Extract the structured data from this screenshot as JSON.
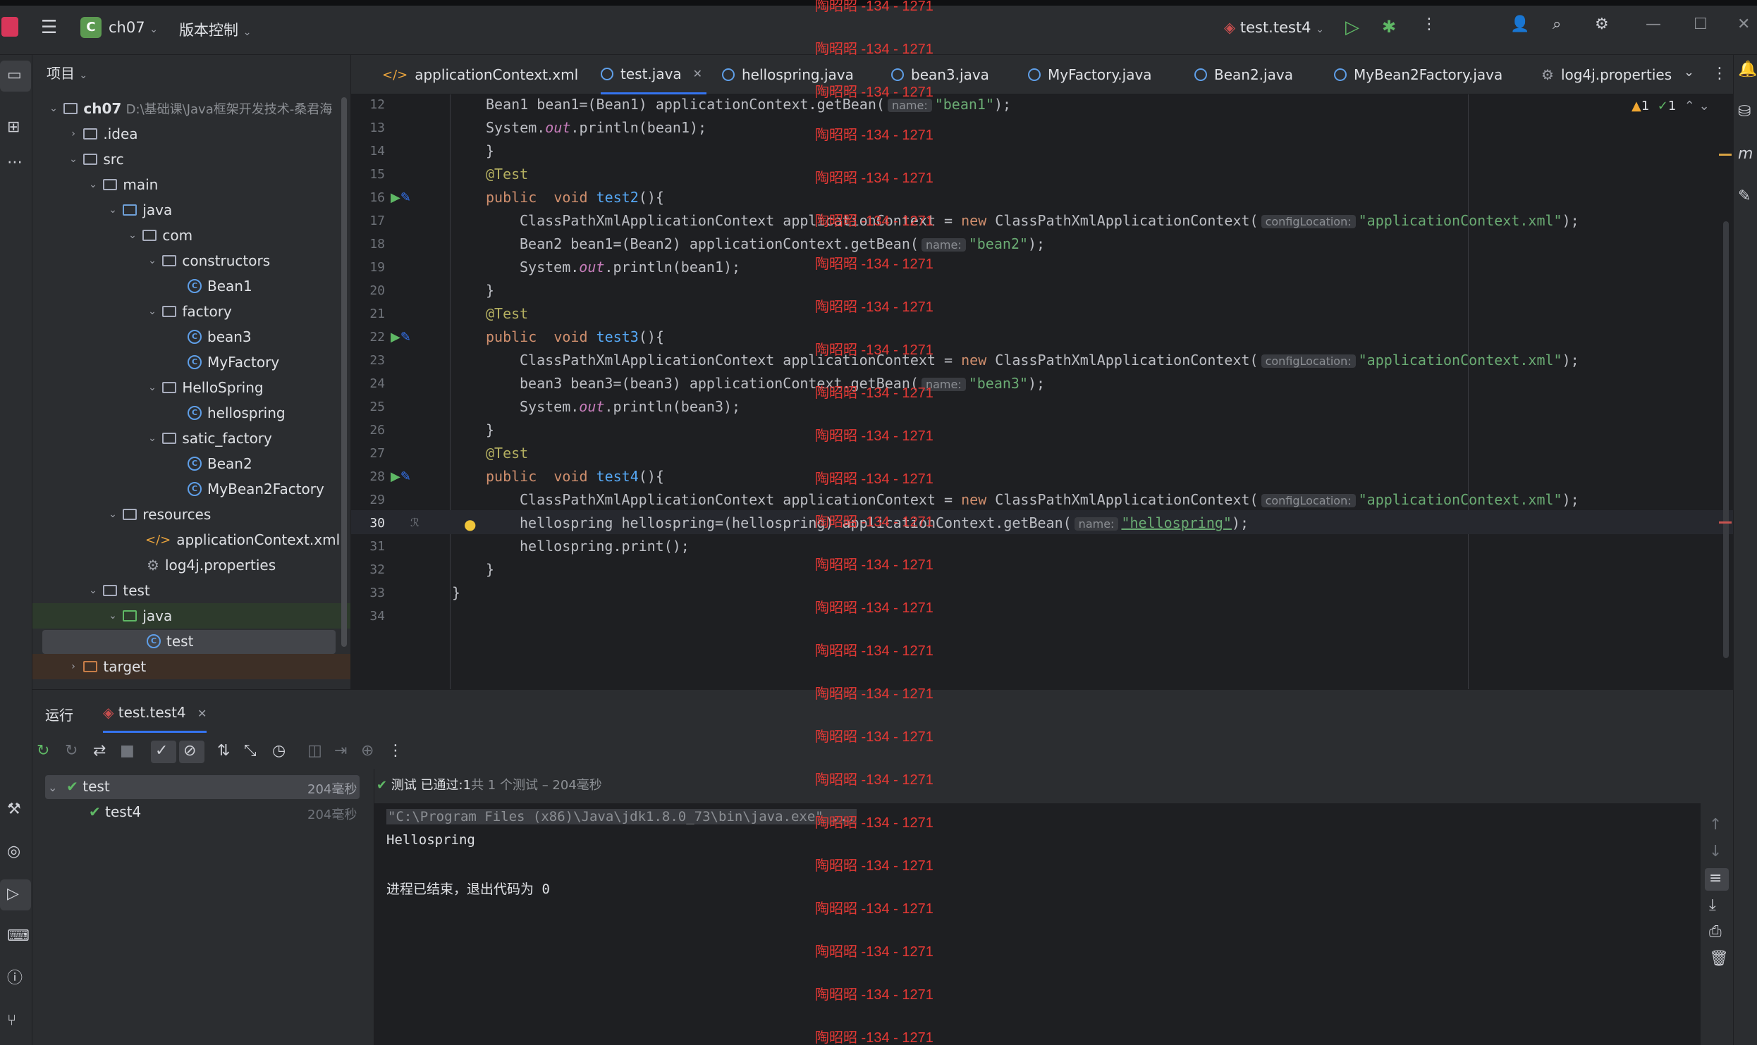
{
  "titlebar": {
    "project_badge": "C",
    "project_name": "ch07",
    "vcs_menu": "版本控制",
    "run_config": "test.test4"
  },
  "project_panel": {
    "title": "项目",
    "tree": [
      {
        "label": "ch07",
        "path": "D:\\基础课\\Java框架开发技术-桑君海",
        "kind": "project"
      },
      {
        "label": ".idea",
        "kind": "folder"
      },
      {
        "label": "src",
        "kind": "folder"
      },
      {
        "label": "main",
        "kind": "folder"
      },
      {
        "label": "java",
        "kind": "source"
      },
      {
        "label": "com",
        "kind": "package"
      },
      {
        "label": "constructors",
        "kind": "package"
      },
      {
        "label": "Bean1",
        "kind": "class"
      },
      {
        "label": "factory",
        "kind": "package"
      },
      {
        "label": "bean3",
        "kind": "class"
      },
      {
        "label": "MyFactory",
        "kind": "class"
      },
      {
        "label": "HelloSpring",
        "kind": "package"
      },
      {
        "label": "hellospring",
        "kind": "class"
      },
      {
        "label": "satic_factory",
        "kind": "package"
      },
      {
        "label": "Bean2",
        "kind": "class"
      },
      {
        "label": "MyBean2Factory",
        "kind": "class"
      },
      {
        "label": "resources",
        "kind": "folder"
      },
      {
        "label": "applicationContext.xml",
        "kind": "xml"
      },
      {
        "label": "log4j.properties",
        "kind": "props"
      },
      {
        "label": "test",
        "kind": "folder"
      },
      {
        "label": "java",
        "kind": "testsource"
      },
      {
        "label": "test",
        "kind": "class"
      },
      {
        "label": "target",
        "kind": "target"
      }
    ]
  },
  "tabs": [
    {
      "label": "applicationContext.xml"
    },
    {
      "label": "test.java",
      "active": true
    },
    {
      "label": "hellospring.java"
    },
    {
      "label": "bean3.java"
    },
    {
      "label": "MyFactory.java"
    },
    {
      "label": "Bean2.java"
    },
    {
      "label": "MyBean2Factory.java"
    },
    {
      "label": "log4j.properties"
    }
  ],
  "inspections": {
    "warnings": "1",
    "ok": "1"
  },
  "editor": {
    "line_numbers": [
      "12",
      "13",
      "14",
      "15",
      "16",
      "17",
      "18",
      "19",
      "20",
      "21",
      "22",
      "23",
      "24",
      "25",
      "26",
      "27",
      "28",
      "29",
      "30",
      "31",
      "32",
      "33",
      "34"
    ],
    "hint_name": "name:",
    "hint_config": "configLocation:",
    "lines": {
      "l12a": "Bean1 bean1=(Bean1) applicationContext.getBean(",
      "l12s": "\"bean1\"",
      "l12e": ");",
      "l13a": "System.",
      "l13b": "out",
      "l13c": ".println(bean1);",
      "brace": "}",
      "annot": "@Test",
      "kw_public": "public",
      "kw_void": "void",
      "m_test2": "test2",
      "m_test3": "test3",
      "m_test4": "test4",
      "paren": "(){",
      "ctx_a": "ClassPathXmlApplicationContext applicationContext = ",
      "kw_new": "new",
      "ctx_b": " ClassPathXmlApplicationContext(",
      "ctx_s": "\"applicationContext.xml\"",
      "l18a": "Bean2 bean1=(Bean2) applicationContext.getBean(",
      "l18s": "\"bean2\"",
      "println1": ".println(bean1);",
      "l24a": "bean3 bean3=(bean3) applicationContext.getBean(",
      "l24s": "\"bean3\"",
      "println3": ".println(bean3);",
      "l30a": "hellospring hellospring=(hellospring) applicationContext.getBean(",
      "l30s": "\"hellospring\"",
      "l31": "hellospring.print();"
    },
    "watermark": "陶昭昭 -134 - 1271"
  },
  "run_panel": {
    "title": "运行",
    "tab": "test.test4",
    "status_passed": "测试 已通过:",
    "status_count": "1",
    "status_detail": "共 1 个测试 – 204毫秒",
    "tree": [
      {
        "label": "test",
        "time": "204毫秒"
      },
      {
        "label": "test4",
        "time": "204毫秒"
      }
    ],
    "console": [
      "\"C:\\Program Files (x86)\\Java\\jdk1.8.0_73\\bin\\java.exe\" ...",
      "Hellospring",
      "",
      "进程已结束，退出代码为 0"
    ]
  }
}
